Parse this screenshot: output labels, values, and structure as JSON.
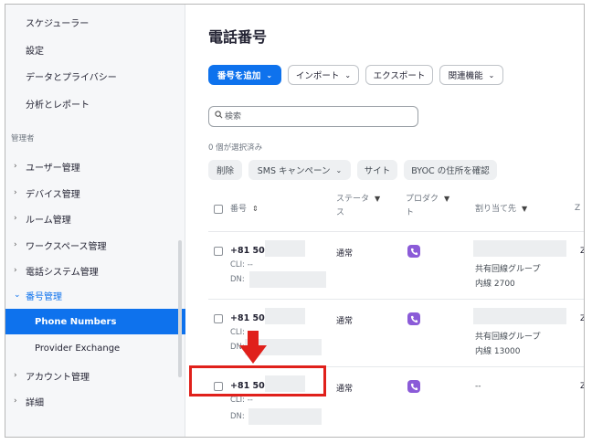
{
  "sidebar": {
    "items": [
      {
        "label": "スケジューラー"
      },
      {
        "label": "設定"
      },
      {
        "label": "データとプライバシー"
      },
      {
        "label": "分析とレポート"
      }
    ],
    "admin_heading": "管理者",
    "admin_items": [
      {
        "label": "ユーザー管理"
      },
      {
        "label": "デバイス管理"
      },
      {
        "label": "ルーム管理"
      },
      {
        "label": "ワークスペース管理"
      },
      {
        "label": "電話システム管理"
      },
      {
        "label": "番号管理"
      }
    ],
    "sub_items": [
      {
        "label": "Phone Numbers"
      },
      {
        "label": "Provider Exchange"
      }
    ],
    "bottom_items": [
      {
        "label": "アカウント管理"
      },
      {
        "label": "詳細"
      }
    ]
  },
  "main": {
    "title": "電話番号",
    "toolbar": {
      "add_number": "番号を追加",
      "import": "インポート",
      "export": "エクスポート",
      "related": "関連機能"
    },
    "search": {
      "placeholder": "検索"
    },
    "selected_count": "0 個が選択済み",
    "bulk_actions": {
      "delete": "削除",
      "sms_campaign": "SMS キャンペーン",
      "site": "サイト",
      "byoc": "BYOC の住所を確認"
    },
    "columns": {
      "number": "番号",
      "status_line1": "ステータ",
      "status_line2": "ス",
      "product_line1": "プロダク",
      "product_line2": "ト",
      "assigned_to": "割り当て先",
      "cut": "Z"
    },
    "rows": [
      {
        "number": "+81 50-",
        "cli": "CLI: --",
        "dn": "DN:",
        "status": "通常",
        "assigned_group": "共有回線グループ",
        "assigned_ext": "内線 2700",
        "cut": "Z"
      },
      {
        "number": "+81 50-",
        "cli": "CLI:",
        "dn": "DN:",
        "status": "通常",
        "assigned_group": "共有回線グループ",
        "assigned_ext": "内線 13000",
        "cut": "Z"
      },
      {
        "number": "+81 50-",
        "cli": "CLI: --",
        "dn": "DN:",
        "status": "通常",
        "assigned_group": "--",
        "assigned_ext": "",
        "cut": "Z"
      }
    ]
  },
  "colors": {
    "accent": "#0e72ed",
    "highlight": "#e0201b",
    "product_icon": "#8b5bd8"
  }
}
